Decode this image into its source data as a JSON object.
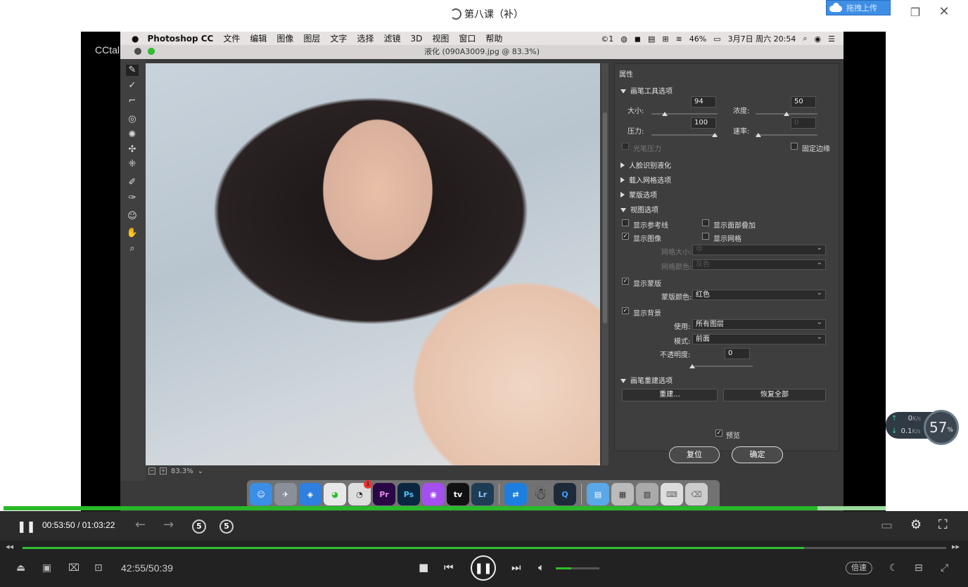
{
  "window": {
    "title": "第八课（补）",
    "upload_label": "拖拽上传",
    "restore_icon": "restore-icon",
    "close_icon": "close-icon"
  },
  "watermark": "CCtalk",
  "mac_menubar": {
    "app": "Photoshop CC",
    "items": [
      "文件",
      "编辑",
      "图像",
      "图层",
      "文字",
      "选择",
      "滤镜",
      "3D",
      "视图",
      "窗口",
      "帮助"
    ],
    "status": {
      "notif": "1",
      "battery": "46%",
      "datetime": "3月7日 周六 20:54"
    }
  },
  "liquify": {
    "title": "液化 (090A3009.jpg @ 83.3%)",
    "zoom": "83.3%",
    "properties_title": "属性",
    "brush_section": "画笔工具选项",
    "size_label": "大小:",
    "size_value": "94",
    "density_label": "浓度:",
    "density_value": "50",
    "pressure_label": "压力:",
    "pressure_value": "100",
    "rate_label": "速率:",
    "rate_value": "0",
    "stylus_label": "光笔压力",
    "pin_edges_label": "固定边缘",
    "sections_collapsed": [
      "人脸识别液化",
      "载入网格选项",
      "蒙版选项"
    ],
    "view_section": "视图选项",
    "show_guides": "显示参考线",
    "show_face_overlay": "显示面部叠加",
    "show_image": "显示图像",
    "show_mesh": "显示网格",
    "mesh_size_label": "网格大小:",
    "mesh_size_value": "中",
    "mesh_color_label": "网格颜色:",
    "mesh_color_value": "灰色",
    "show_mask": "显示蒙版",
    "mask_color_label": "蒙版颜色:",
    "mask_color_value": "红色",
    "show_backdrop": "显示背景",
    "use_label": "使用:",
    "use_value": "所有图层",
    "mode_label": "模式:",
    "mode_value": "前面",
    "opacity_label": "不透明度:",
    "opacity_value": "0",
    "reconstruct_section": "画笔重建选项",
    "reconstruct_btn": "重建...",
    "restore_all_btn": "恢复全部",
    "preview_label": "预览",
    "reset_btn": "复位",
    "ok_btn": "确定"
  },
  "dock": {
    "badge": "1",
    "apps": [
      "Pr",
      "Ps",
      "Lr"
    ]
  },
  "netspeed": {
    "up": "0",
    "up_unit": "K/s",
    "down": "0.1",
    "down_unit": "K/s",
    "percent": "57",
    "percent_unit": "%"
  },
  "player": {
    "current_time": "00:53:50",
    "separator": "/",
    "total_time": "01:03:22",
    "progress": 0.923,
    "skip_back": "5",
    "skip_forward": "5",
    "bottom_time": "42:55/50:39",
    "bottom_progress": 0.846,
    "volume": 0.35,
    "speed_label": "倍速"
  }
}
